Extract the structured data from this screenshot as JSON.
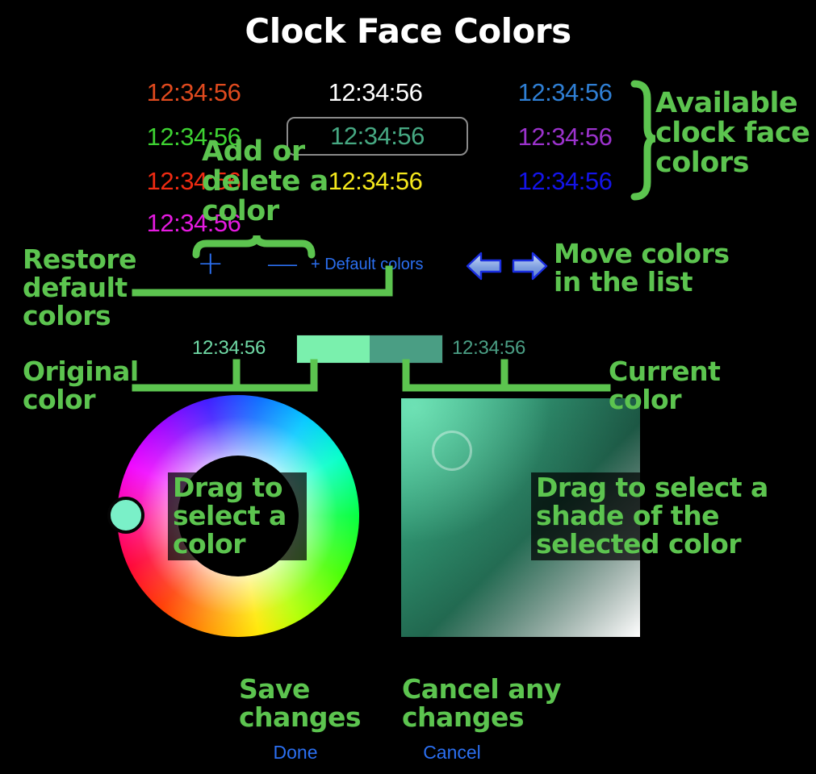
{
  "window": {
    "title": "Clock Face Colors",
    "background": "#000000"
  },
  "color_list": {
    "sample_time": "12:34:56",
    "columns": [
      {
        "index": 0,
        "swatches": [
          {
            "label": "12:34:56",
            "color": "#e04a1e",
            "name": "orange"
          },
          {
            "label": "12:34:56",
            "color": "#3ed232",
            "name": "green"
          },
          {
            "label": "12:34:56",
            "color": "#f02b12",
            "name": "red"
          },
          {
            "label": "12:34:56",
            "color": "#e51ae0",
            "name": "magenta"
          }
        ]
      },
      {
        "index": 1,
        "swatches": [
          {
            "label": "12:34:56",
            "color": "#ffffff",
            "name": "white"
          },
          {
            "label": "12:34:56",
            "color": "#46a882",
            "name": "teal",
            "selected": true
          },
          {
            "label": "12:34:56",
            "color": "#f5e81c",
            "name": "yellow"
          }
        ]
      },
      {
        "index": 2,
        "swatches": [
          {
            "label": "12:34:56",
            "color": "#2f7fd4",
            "name": "light-blue"
          },
          {
            "label": "12:34:56",
            "color": "#9b32cc",
            "name": "purple"
          },
          {
            "label": "12:34:56",
            "color": "#1414e8",
            "name": "blue"
          }
        ]
      }
    ]
  },
  "toolbar": {
    "add_label": "+",
    "delete_label": "—",
    "default_colors_label": "+ Default colors",
    "accent": "#2b6ff0",
    "move_left_icon": "arrow-left-icon",
    "move_right_icon": "arrow-right-icon"
  },
  "compare": {
    "original_label": "12:34:56",
    "current_label": "12:34:56",
    "original_color": "#7af0ad",
    "current_color": "#4a9e84",
    "text_color": "#6fd9a5"
  },
  "wheel": {
    "knob_color": "#7af0c8",
    "center_hole_color": "#000000"
  },
  "shade": {
    "knob_outline": "rgba(255,255,255,0.38)",
    "base_color": "#3fc596"
  },
  "buttons": {
    "done_label": "Done",
    "cancel_label": "Cancel",
    "accent": "#2b6ff0"
  },
  "annotations": {
    "available": "Available\nclock face\ncolors",
    "add_delete": "Add or\ndelete a\ncolor",
    "restore_default": "Restore\ndefault\ncolors",
    "move_colors": "Move colors\nin the list",
    "original_color": "Original\ncolor",
    "current_color": "Current\ncolor",
    "drag_color": "Drag to\nselect a\ncolor",
    "drag_shade": "Drag to select a\nshade of the\nselected color",
    "save_changes": "Save\nchanges",
    "cancel_changes": "Cancel any\nchanges",
    "color": "#5cc44f"
  }
}
